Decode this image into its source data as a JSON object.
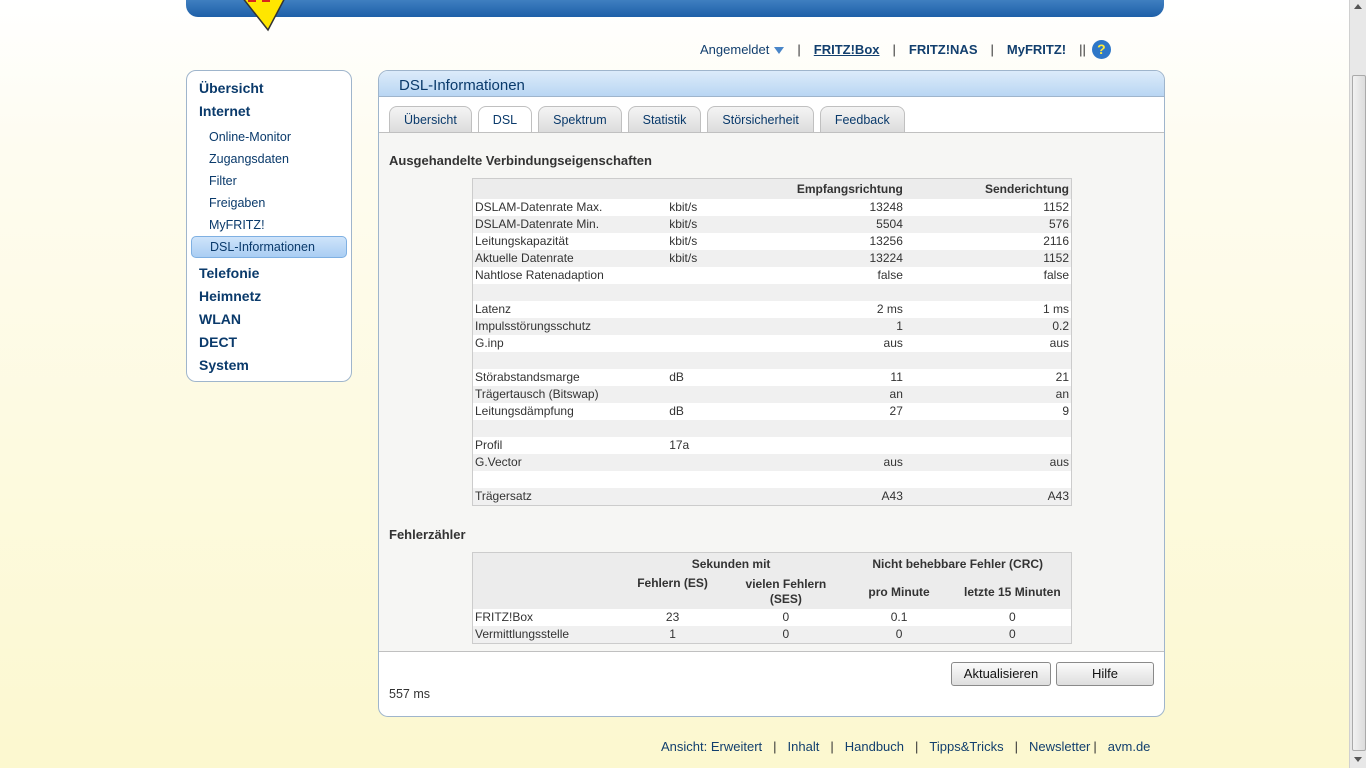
{
  "topnav": {
    "logged_in": "Angemeldet",
    "fritzbox": "FRITZ!Box",
    "fritznas": "FRITZ!NAS",
    "myfritz": "MyFRITZ!",
    "help_symbol": "?"
  },
  "sidebar": {
    "main": [
      "Übersicht",
      "Internet",
      "Telefonie",
      "Heimnetz",
      "WLAN",
      "DECT",
      "System"
    ],
    "sub": [
      "Online-Monitor",
      "Zugangsdaten",
      "Filter",
      "Freigaben",
      "MyFRITZ!",
      "DSL-Informationen"
    ]
  },
  "panel": {
    "title": "DSL-Informationen",
    "tabs": [
      "Übersicht",
      "DSL",
      "Spektrum",
      "Statistik",
      "Störsicherheit",
      "Feedback"
    ],
    "active_tab": "DSL"
  },
  "connection": {
    "title": "Ausgehandelte Verbindungseigenschaften",
    "headers": [
      "",
      "",
      "Empfangsrichtung",
      "Senderichtung"
    ],
    "rows": [
      [
        "DSLAM-Datenrate Max.",
        "kbit/s",
        "13248",
        "1152"
      ],
      [
        "DSLAM-Datenrate Min.",
        "kbit/s",
        "5504",
        "576"
      ],
      [
        "Leitungskapazität",
        "kbit/s",
        "13256",
        "2116"
      ],
      [
        "Aktuelle Datenrate",
        "kbit/s",
        "13224",
        "1152"
      ],
      [
        "Nahtlose Ratenadaption",
        "",
        "false",
        "false"
      ],
      [
        "",
        "",
        "",
        ""
      ],
      [
        "Latenz",
        "",
        "2 ms",
        "1 ms"
      ],
      [
        "Impulsstörungsschutz",
        "",
        "1",
        "0.2"
      ],
      [
        "G.inp",
        "",
        "aus",
        "aus"
      ],
      [
        "",
        "",
        "",
        ""
      ],
      [
        "Störabstandsmarge",
        "dB",
        "11",
        "21"
      ],
      [
        "Trägertausch (Bitswap)",
        "",
        "an",
        "an"
      ],
      [
        "Leitungsdämpfung",
        "dB",
        "27",
        "9"
      ],
      [
        "",
        "",
        "",
        ""
      ],
      [
        "Profil",
        "17a",
        "",
        ""
      ],
      [
        "G.Vector",
        "",
        "aus",
        "aus"
      ],
      [
        "",
        "",
        "",
        ""
      ],
      [
        "Trägersatz",
        "",
        "A43",
        "A43"
      ]
    ]
  },
  "errors": {
    "title": "Fehlerzähler",
    "group1": "Sekunden mit",
    "group2": "Nicht behebbare Fehler (CRC)",
    "cols": [
      "Fehlern (ES)",
      "vielen Fehlern (SES)",
      "pro Minute",
      "letzte 15 Minuten"
    ],
    "rows": [
      [
        "FRITZ!Box",
        "23",
        "0",
        "0.1",
        "0"
      ],
      [
        "Vermittlungsstelle",
        "1",
        "0",
        "0",
        "0"
      ]
    ]
  },
  "buttons": {
    "refresh": "Aktualisieren",
    "help": "Hilfe"
  },
  "timing": "557 ms",
  "footer": {
    "view": "Ansicht: Erweitert",
    "content": "Inhalt",
    "manual": "Handbuch",
    "tips": "Tipps&Tricks",
    "newsletter": "Newsletter",
    "avm": "avm.de"
  },
  "colors": {
    "accent": "#0a3a6b",
    "header_blue": "#1e5fa8",
    "logo_yellow": "#ffe600",
    "logo_red": "#d9261c"
  }
}
